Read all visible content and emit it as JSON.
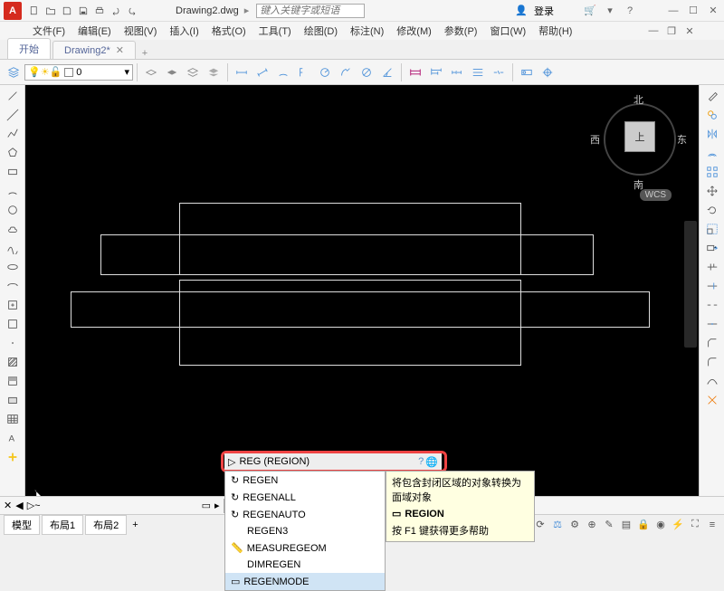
{
  "title": "Drawing2.dwg",
  "search_placeholder": "键入关键字或短语",
  "login_label": "登录",
  "menus": [
    "文件(F)",
    "编辑(E)",
    "视图(V)",
    "插入(I)",
    "格式(O)",
    "工具(T)",
    "绘图(D)",
    "标注(N)",
    "修改(M)",
    "参数(P)",
    "窗口(W)",
    "帮助(H)"
  ],
  "tabs": {
    "start": "开始",
    "doc": "Drawing2*"
  },
  "layer": {
    "name": "0",
    "color": "#ffffff"
  },
  "viewcube": {
    "n": "北",
    "s": "南",
    "e": "东",
    "w": "西",
    "face": "上",
    "wcs": "WCS"
  },
  "command": {
    "typed": "REG",
    "resolved": "REG (REGION)",
    "suggestions": [
      "REGEN",
      "REGENALL",
      "REGENAUTO",
      "REGEN3",
      "MEASUREGEOM",
      "DIMREGEN",
      "REGENMODE"
    ]
  },
  "tooltip": {
    "desc": "将包含封闭区域的对象转换为面域对象",
    "cmd": "REGION",
    "help": "按 F1 键获得更多帮助"
  },
  "cmdbar_prefix": "▷~",
  "status_tabs": [
    "模型",
    "布局1",
    "布局2"
  ],
  "status_model": "模型"
}
